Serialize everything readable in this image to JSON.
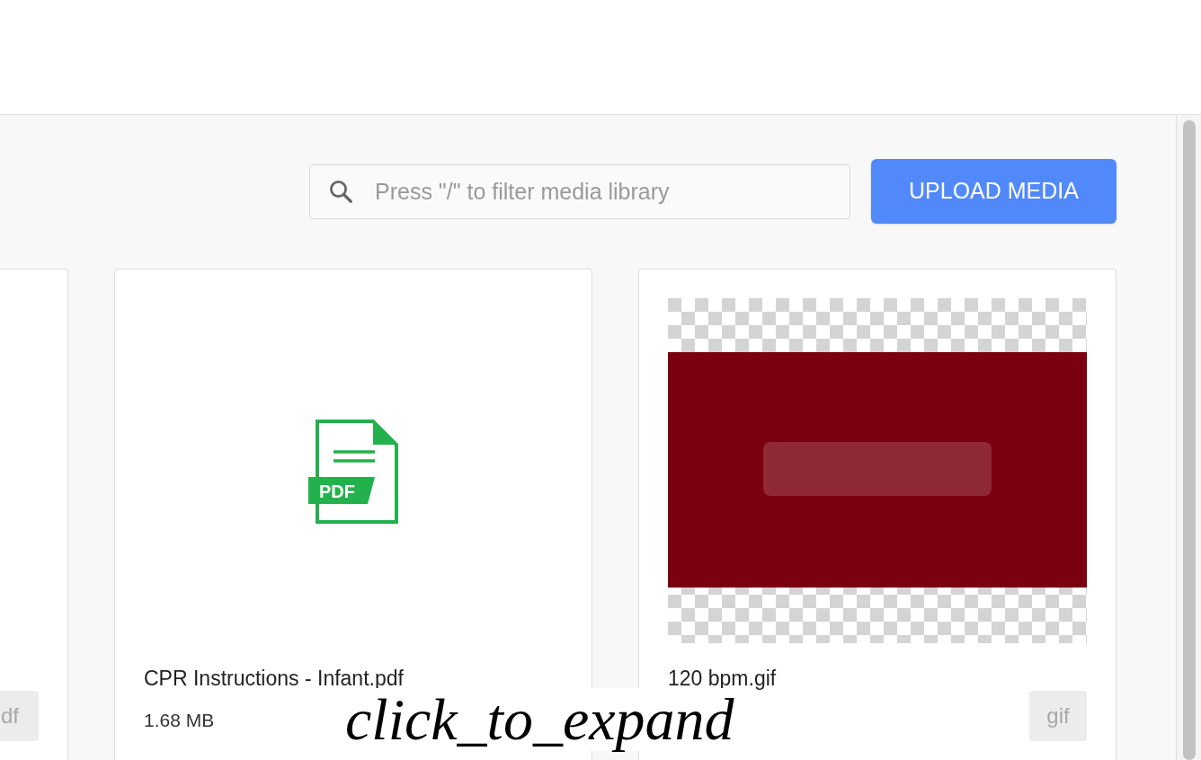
{
  "search": {
    "placeholder": "Press \"/\" to filter media library"
  },
  "upload_button": "UPLOAD MEDIA",
  "cards": [
    {
      "kind": "blank",
      "badge": "df"
    },
    {
      "kind": "file",
      "icon_label": "PDF",
      "title": "CPR Instructions - Infant.pdf",
      "size": "1.68 MB"
    },
    {
      "kind": "picture",
      "title": "120 bpm.gif",
      "badge": "gif"
    }
  ],
  "caption": "click_to_expand"
}
